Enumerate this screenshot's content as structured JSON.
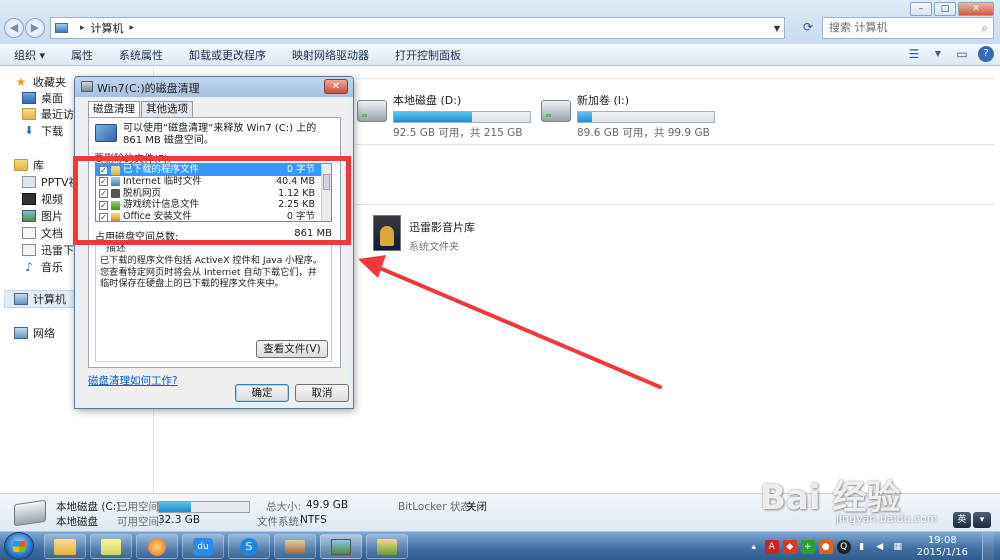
{
  "explorer": {
    "address": {
      "path": "计算机",
      "search_placeholder": "搜索 计算机"
    },
    "toolbar": {
      "organize": "组织 ▾",
      "properties": "属性",
      "system_properties": "系统属性",
      "uninstall": "卸载或更改程序",
      "map_drive": "映射网络驱动器",
      "control_panel": "打开控制面板"
    },
    "nav": {
      "favorites": "收藏夹",
      "desktop": "桌面",
      "recent": "最近访问",
      "downloads": "下载",
      "libraries": "库",
      "pptv": "PPTV视",
      "videos": "视频",
      "pictures": "图片",
      "documents": "文档",
      "xunlei": "迅雷下载",
      "music": "音乐",
      "computer": "计算机",
      "network": "网络"
    },
    "drives": [
      {
        "name": "本地磁盘 (D:)",
        "info": "92.5 GB 可用，共 215 GB",
        "used_fraction": 0.57
      },
      {
        "name": "新加卷 (I:)",
        "info": "89.6 GB 可用，共 99.9 GB",
        "used_fraction": 0.1
      }
    ],
    "library": {
      "name": "迅雷影音片库",
      "type": "系统文件夹"
    },
    "details": {
      "name": "本地磁盘 (C:)",
      "type": "本地磁盘",
      "used_label": "已用空间:",
      "free_label": "可用空间:",
      "free_value": "32.3 GB",
      "total_label": "总大小:",
      "total_value": "49.9 GB",
      "fs_label": "文件系统:",
      "fs_value": "NTFS",
      "bitlocker_label": "BitLocker 状态:",
      "bitlocker_value": "关闭",
      "used_fraction": 0.35
    }
  },
  "dialog": {
    "title": "Win7(C:)的磁盘清理",
    "tabs": [
      "磁盘清理",
      "其他选项"
    ],
    "intro": "可以使用“磁盘清理”来释放 Win7 (C:) 上的 861 MB 磁盘空间。",
    "delete_label": "要删除的文件(F):",
    "files": [
      {
        "name": "已下载的程序文件",
        "size": "0 字节",
        "checked": true,
        "selected": true
      },
      {
        "name": "Internet 临时文件",
        "size": "40.4 MB",
        "checked": true,
        "selected": false
      },
      {
        "name": "脱机网页",
        "size": "1.12 KB",
        "checked": true,
        "selected": false
      },
      {
        "name": "游戏统计信息文件",
        "size": "2.25 KB",
        "checked": true,
        "selected": false
      },
      {
        "name": "Office 安装文件",
        "size": "0 字节",
        "checked": true,
        "selected": false
      }
    ],
    "total_label": "占用磁盘空间总数:",
    "total_value": "861 MB",
    "desc_title": "描述",
    "desc_text": "已下载的程序文件包括 ActiveX 控件和 Java 小程序。您查看特定网页时将会从 Internet 自动下载它们，并临时保存在硬盘上的已下载的程序文件夹中。",
    "view_files": "查看文件(V)",
    "help_link": "磁盘清理如何工作?",
    "ok": "确定",
    "cancel": "取消"
  },
  "taskbar": {
    "clock_time": "19:08",
    "clock_date": "2015/1/16"
  },
  "watermark": {
    "brand": "Bai 经验",
    "url": "jingyan.baidu.com"
  },
  "colors": {
    "annotation_red": "#f03a3a",
    "selection_blue": "#3399ff",
    "link_blue": "#0b5bd3"
  }
}
